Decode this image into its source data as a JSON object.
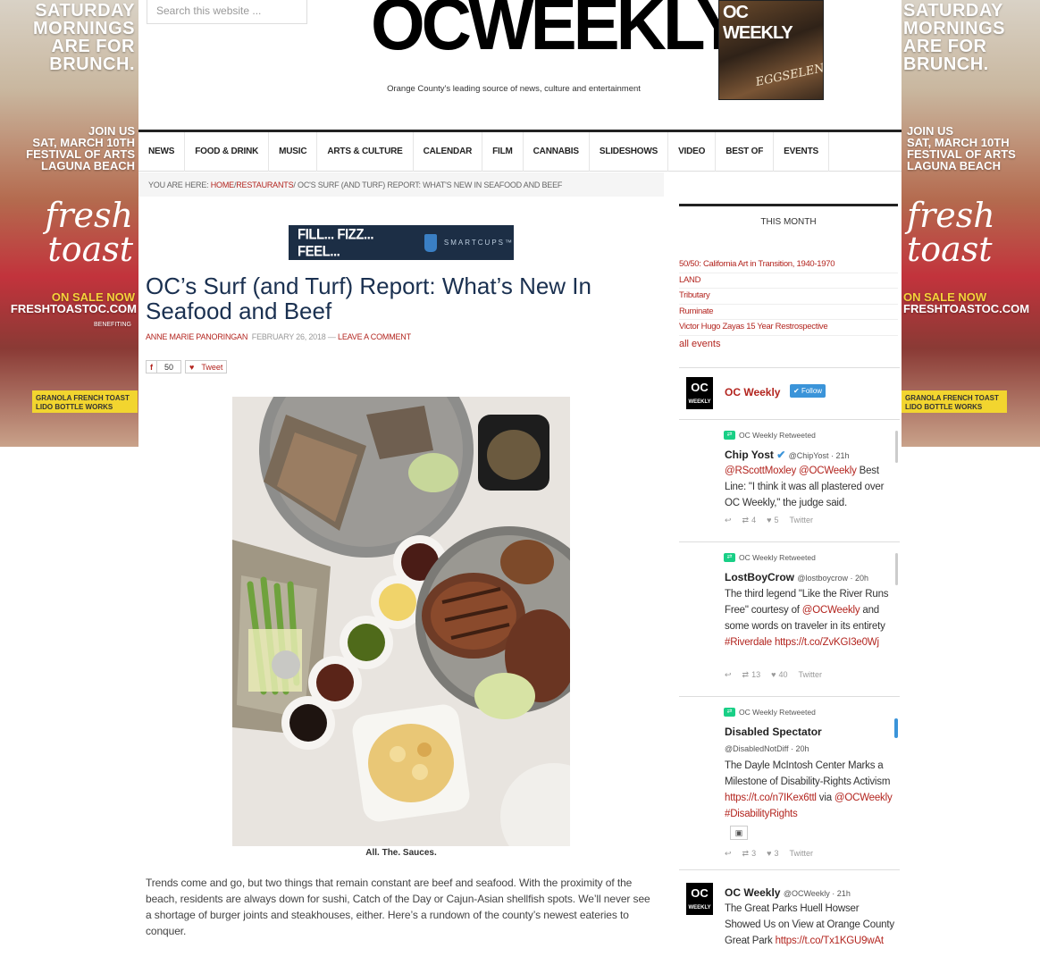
{
  "side_ad": {
    "headline": [
      "SATURDAY",
      "MORNINGS",
      "ARE FOR",
      "BRUNCH."
    ],
    "join": [
      "JOIN US",
      "SAT, MARCH 10TH",
      "FESTIVAL OF ARTS",
      "LAGUNA BEACH"
    ],
    "brand": "fresh toast",
    "sale": "ON SALE NOW",
    "site": "FRESHTOASTOC.COM",
    "benefit": "BENEFITING",
    "sponsors": "GRANOLA FRENCH TOAST LIDO BOTTLE WORKS"
  },
  "header": {
    "search_placeholder": "Search this website ...",
    "logo": "OCWEEKLY",
    "logo_mark": "®",
    "tagline": "Orange County's leading source of news, culture and entertainment",
    "magazine_title": "OC WEEKLY",
    "magazine_cover": "EGGSELENCE"
  },
  "nav": [
    "NEWS",
    "FOOD & DRINK",
    "MUSIC",
    "ARTS & CULTURE",
    "CALENDAR",
    "FILM",
    "CANNABIS",
    "SLIDESHOWS",
    "VIDEO",
    "BEST OF",
    "EVENTS"
  ],
  "breadcrumb": {
    "prefix": "YOU ARE HERE:",
    "home": "HOME",
    "sep": "/",
    "section": "RESTAURANTS",
    "current": "OC'S SURF (AND TURF) REPORT: WHAT'S NEW IN SEAFOOD AND BEEF"
  },
  "banner": {
    "text": "FILL... FIZZ... FEEL...",
    "brand": "SMARTCUPS™"
  },
  "article": {
    "title": "OC’s Surf (and Turf) Report: What’s New In Seafood and Beef",
    "author": "ANNE MARIE PANORINGAN",
    "date": "FEBRUARY 26, 2018",
    "dash": "—",
    "comment": "LEAVE A COMMENT",
    "fb_count": "50",
    "tweet_label": "Tweet",
    "caption": "All. The. Sauces.",
    "body": "Trends come and go, but two things that remain constant are beef and seafood. With the proximity of the beach, residents are always down for sushi, Catch of the Day or Cajun-Asian shellfish spots. We’ll never see a shortage of burger joints and steakhouses, either. Here’s a rundown of the county’s newest eateries to conquer."
  },
  "sidebar": {
    "title": "THIS MONTH",
    "events": [
      "50/50: California Art in Transition, 1940-1970",
      "LAND",
      "Tributary",
      "Ruminate",
      "Victor Hugo Zayas 15 Year Restrospective"
    ],
    "all_events": "all events",
    "twitter": {
      "name": "OC Weekly",
      "follow": "Follow",
      "tweets": [
        {
          "rt": "OC Weekly Retweeted",
          "author": "Chip Yost",
          "handle": "@ChipYost · 21h",
          "text_html_parts": [
            "@RScottMoxley @OCWeekly",
            " Best Line: \"I think it was all plastered over OC Weekly,\" the judge said."
          ],
          "retweets": "4",
          "likes": "5",
          "source": "Twitter"
        },
        {
          "rt": "OC Weekly Retweeted",
          "author": "LostBoyCrow",
          "handle": "@lostboycrow · 20h",
          "text_html_parts": [
            "The third legend \"Like the River Runs Free\" courtesy of ",
            "@OCWeekly",
            " and some words on traveler in its entirety ",
            "#Riverdale",
            " ",
            "https://t.co/ZvKGI3e0Wj"
          ],
          "retweets": "13",
          "likes": "40",
          "source": "Twitter"
        },
        {
          "rt": "OC Weekly Retweeted",
          "author": "Disabled Spectator",
          "handle": "@DisabledNotDiff · 20h",
          "text_html_parts": [
            "The Dayle McIntosh Center Marks a Milestone of Disability-Rights Activism ",
            "https://t.co/n7IKex6ttl",
            " via ",
            "@OCWeekly #DisabilityRights"
          ],
          "retweets": "3",
          "likes": "3",
          "source": "Twitter"
        },
        {
          "author": "OC Weekly",
          "handle": "@OCWeekly · 21h",
          "text_html_parts": [
            "The Great Parks Huell Howser Showed Us on View at Orange County Great Park ",
            "https://t.co/Tx1KGU9wAt"
          ]
        }
      ]
    }
  },
  "colors": {
    "link": "#b3251f",
    "title": "#1a3050",
    "retweet": "#19cf86",
    "follow": "#3b94d9"
  }
}
